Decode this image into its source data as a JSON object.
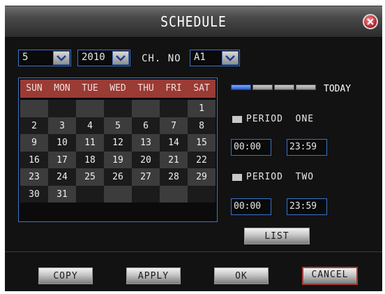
{
  "title": "SCHEDULE",
  "month": "5",
  "year": "2010",
  "channel_label": "CH. NO",
  "channel": "A1",
  "weekdays": [
    "SUN",
    "MON",
    "TUE",
    "WED",
    "THU",
    "FRI",
    "SAT"
  ],
  "days": [
    "",
    "",
    "",
    "",
    "",
    "",
    "1",
    "2",
    "3",
    "4",
    "5",
    "6",
    "7",
    "8",
    "9",
    "10",
    "11",
    "12",
    "13",
    "14",
    "15",
    "16",
    "17",
    "18",
    "19",
    "20",
    "21",
    "22",
    "23",
    "24",
    "25",
    "26",
    "27",
    "28",
    "29",
    "30",
    "31",
    "",
    "",
    "",
    "",
    ""
  ],
  "today_label": "TODAY",
  "period_one": {
    "label": "PERIOD  ONE",
    "start": "00:00",
    "end": "23:59"
  },
  "period_two": {
    "label": "PERIOD  TWO",
    "start": "00:00",
    "end": "23:59"
  },
  "list_label": "LIST",
  "buttons": {
    "copy": "COPY",
    "apply": "APPLY",
    "ok": "OK",
    "cancel": "CANCEL"
  },
  "colors": {
    "accent": "#3b73c9",
    "header": "#9a3b34",
    "today_bar": "#2b58c9"
  }
}
